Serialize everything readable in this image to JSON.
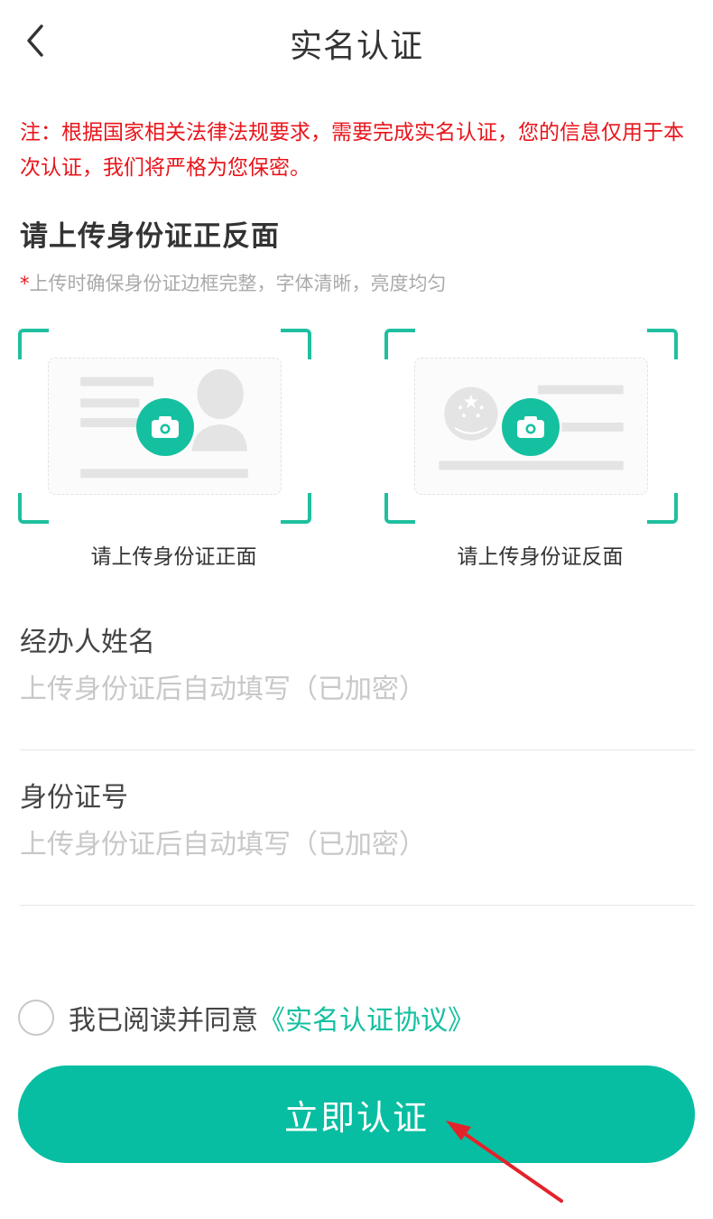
{
  "header": {
    "title": "实名认证"
  },
  "notice": "注：根据国家相关法律法规要求，需要完成实名认证，您的信息仅用于本次认证，我们将严格为您保密。",
  "upload": {
    "title": "请上传身份证正反面",
    "tip_star": "*",
    "tip": "上传时确保身份证边框完整，字体清晰，亮度均匀",
    "front_label": "请上传身份证正面",
    "back_label": "请上传身份证反面"
  },
  "form": {
    "name_label": "经办人姓名",
    "name_placeholder": "上传身份证后自动填写（已加密）",
    "id_label": "身份证号",
    "id_placeholder": "上传身份证后自动填写（已加密）"
  },
  "agreement": {
    "text": "我已阅读并同意",
    "link": "《实名认证协议》"
  },
  "submit_label": "立即认证",
  "colors": {
    "accent": "#15c0a0",
    "warning": "#e8151b",
    "annotation_arrow": "#e3232b"
  },
  "icons": {
    "back": "chevron-left-icon",
    "camera": "camera-icon"
  }
}
